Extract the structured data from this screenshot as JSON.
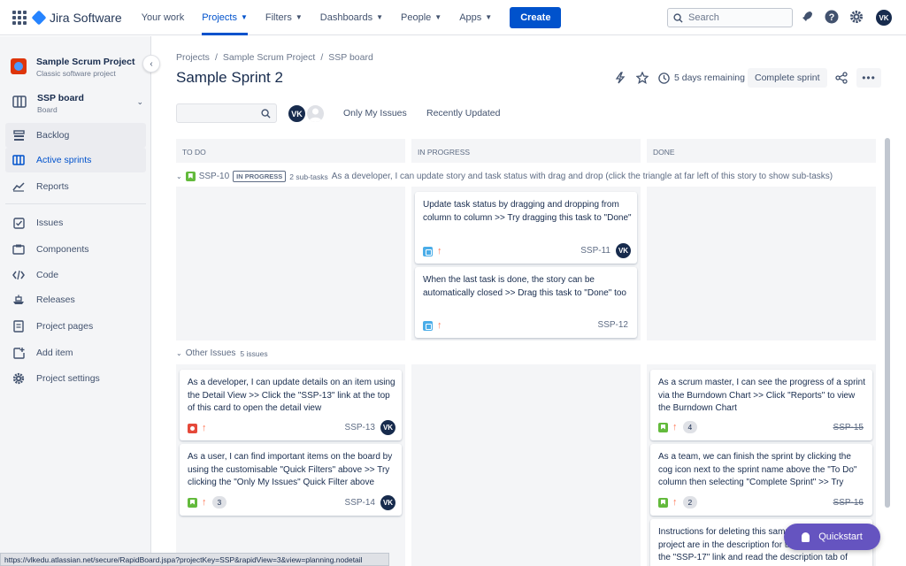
{
  "topnav": {
    "product": "Jira Software",
    "items": [
      {
        "label": "Your work",
        "dropdown": false,
        "active": false
      },
      {
        "label": "Projects",
        "dropdown": true,
        "active": true
      },
      {
        "label": "Filters",
        "dropdown": true,
        "active": false
      },
      {
        "label": "Dashboards",
        "dropdown": true,
        "active": false
      },
      {
        "label": "People",
        "dropdown": true,
        "active": false
      },
      {
        "label": "Apps",
        "dropdown": true,
        "active": false
      }
    ],
    "create_label": "Create",
    "search_placeholder": "Search",
    "user_initials": "VK",
    "accent": "#0052cc"
  },
  "sidebar": {
    "project_name": "Sample Scrum Project",
    "project_type": "Classic software project",
    "board_name": "SSP board",
    "board_sub": "Board",
    "items": [
      {
        "label": "Backlog",
        "icon": "backlog-icon"
      },
      {
        "label": "Active sprints",
        "icon": "board-columns-icon"
      },
      {
        "label": "Reports",
        "icon": "chart-icon"
      },
      {
        "label": "Issues",
        "icon": "issues-icon"
      },
      {
        "label": "Components",
        "icon": "component-icon"
      },
      {
        "label": "Code",
        "icon": "code-icon"
      },
      {
        "label": "Releases",
        "icon": "ship-icon"
      },
      {
        "label": "Project pages",
        "icon": "page-icon"
      },
      {
        "label": "Add item",
        "icon": "add-item-icon"
      },
      {
        "label": "Project settings",
        "icon": "gear-icon"
      }
    ]
  },
  "header": {
    "breadcrumb": [
      "Projects",
      "Sample Scrum Project",
      "SSP board"
    ],
    "title": "Sample Sprint 2",
    "remaining": "5 days remaining",
    "complete_label": "Complete sprint"
  },
  "filters": {
    "avatar_initials": "VK",
    "only_my_issues": "Only My Issues",
    "recently_updated": "Recently Updated"
  },
  "columns": [
    "TO DO",
    "IN PROGRESS",
    "DONE"
  ],
  "swimlanes": {
    "story": {
      "key": "SSP-10",
      "status": "IN PROGRESS",
      "subtasks": "2 sub-tasks",
      "summary": "As a developer, I can update story and task status with drag and drop (click the triangle at far left of this story to show sub-tasks)"
    },
    "other": {
      "label": "Other Issues",
      "count": "5 issues"
    }
  },
  "cards": {
    "ssp11": {
      "summary": "Update task status by dragging and dropping from column to column >> Try dragging this task to \"Done\"",
      "key": "SSP-11",
      "assignee": "VK"
    },
    "ssp12": {
      "summary": "When the last task is done, the story can be automatically closed >> Drag this task to \"Done\" too",
      "key": "SSP-12"
    },
    "ssp13": {
      "summary": "As a developer, I can update details on an item using the Detail View >> Click the \"SSP-13\" link at the top of this card to open the detail view",
      "key": "SSP-13",
      "assignee": "VK"
    },
    "ssp14": {
      "summary": "As a user, I can find important items on the board by using the customisable \"Quick Filters\" above >> Try clicking the \"Only My Issues\" Quick Filter above",
      "key": "SSP-14",
      "points": "3",
      "assignee": "VK"
    },
    "ssp15": {
      "summary": "As a scrum master, I can see the progress of a sprint via the Burndown Chart >> Click \"Reports\" to view the Burndown Chart",
      "key": "SSP-15",
      "points": "4"
    },
    "ssp16": {
      "summary": "As a team, we can finish the sprint by clicking the cog icon next to the sprint name above the \"To Do\" column then selecting \"Complete Sprint\" >> Try",
      "key": "SSP-16",
      "points": "2"
    },
    "ssp17": {
      "summary": "Instructions for deleting this sample board and project are in the description for this issue >> Click the \"SSP-17\" link and read the description tab of"
    }
  },
  "statusbar": "https://vlkedu.atlassian.net/secure/RapidBoard.jspa?projectKey=SSP&rapidView=3&view=planning.nodetail",
  "quickstart": "Quickstart"
}
